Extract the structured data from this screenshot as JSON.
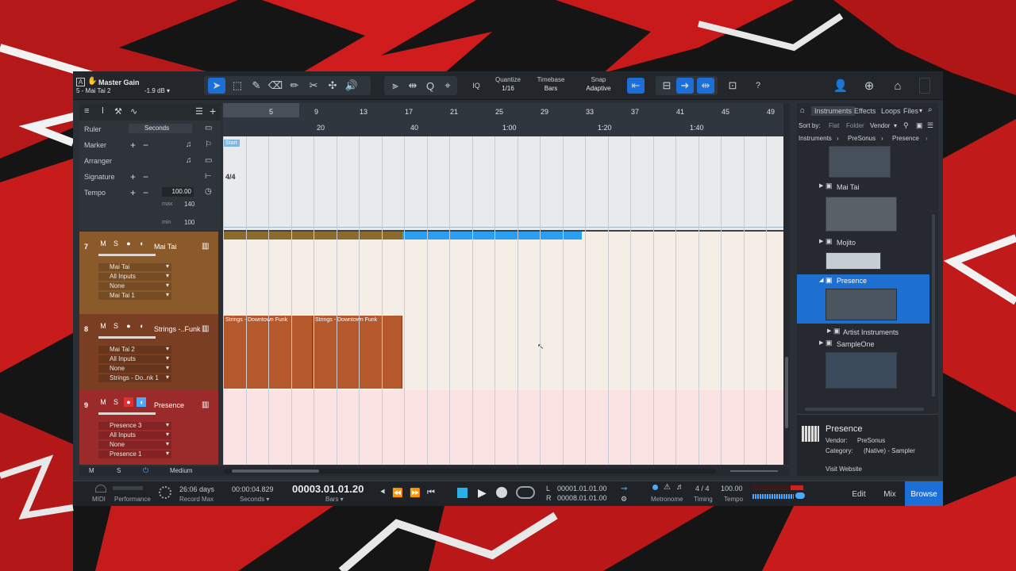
{
  "header": {
    "title": "Master Gain",
    "song": "5 - Mai Tai 2",
    "gain": "-1.9 dB ▾"
  },
  "toolbar": {
    "quantize_label": "Quantize",
    "quantize_value": "1/16",
    "timebase_label": "Timebase",
    "timebase_value": "Bars",
    "snap_label": "Snap",
    "snap_value": "Adaptive",
    "iq_label": "IQ",
    "help_label": "?"
  },
  "global_tracks": {
    "ruler_label": "Ruler",
    "ruler_value": "Seconds",
    "marker_label": "Marker",
    "arranger_label": "Arranger",
    "signature_label": "Signature",
    "tempo_label": "Tempo",
    "tempo_value": "100.00",
    "max_label": "max",
    "max_value": "140",
    "min_label": "min",
    "min_value": "100",
    "start_marker": "Start",
    "signature_value": "4/4"
  },
  "ruler": {
    "bars": [
      "5",
      "9",
      "13",
      "17",
      "21",
      "25",
      "29",
      "33",
      "37",
      "41",
      "45",
      "49"
    ],
    "seconds": [
      "20",
      "40",
      "1:00",
      "1:20",
      "1:40"
    ]
  },
  "tracks": [
    {
      "num": "7",
      "name": "Mai Tai",
      "io": [
        "Mai Tai",
        "All Inputs",
        "None",
        "Mai Tai 1"
      ],
      "color": "#8a5a2b"
    },
    {
      "num": "8",
      "name": "Strings -..Funk",
      "io": [
        "Mai Tai 2",
        "All Inputs",
        "None",
        "Strings - Do..nk 1"
      ],
      "color": "#7a3e22"
    },
    {
      "num": "9",
      "name": "Presence",
      "io": [
        "Presence 3",
        "All Inputs",
        "None",
        "Presence 1"
      ],
      "color": "#9b2a2a"
    }
  ],
  "track_buttons": {
    "mute": "M",
    "solo": "S"
  },
  "clips": [
    "Strings - Downtown Funk",
    "Strings - Downtown Funk"
  ],
  "arrange_footer": {
    "mute": "M",
    "solo": "S",
    "zoom": "Medium"
  },
  "browser": {
    "tabs": [
      "Instruments",
      "Effects",
      "Loops",
      "Files"
    ],
    "sort_label": "Sort by:",
    "sort_flat": "Flat",
    "sort_folder": "Folder",
    "sort_vendor": "Vendor",
    "path": [
      "Instruments",
      "PreSonus",
      "Presence"
    ],
    "items": [
      "Mai Tai",
      "Mojito",
      "Presence",
      "Artist Instruments",
      "SampleOne"
    ],
    "info_name": "Presence",
    "info_vendor_label": "Vendor:",
    "info_vendor": "PreSonus",
    "info_category_label": "Category:",
    "info_category": "(Native) - Sampler",
    "visit": "Visit Website"
  },
  "transport": {
    "midi": "MIDI",
    "performance": "Performance",
    "record_days": "26:06 days",
    "record_max": "Record Max",
    "seconds_value": "00:00:04.829",
    "seconds_label": "Seconds ▾",
    "bars_value": "00003.01.01.20",
    "bars_label": "Bars ▾",
    "loop_l_label": "L",
    "loop_l": "00001.01.01.00",
    "loop_r_label": "R",
    "loop_r": "00008.01.01.00",
    "metronome": "Metronome",
    "timing_value": "4 / 4",
    "timing_label": "Timing",
    "tempo_value": "100.00",
    "tempo_label": "Tempo",
    "edit": "Edit",
    "mix": "Mix",
    "browse": "Browse"
  }
}
